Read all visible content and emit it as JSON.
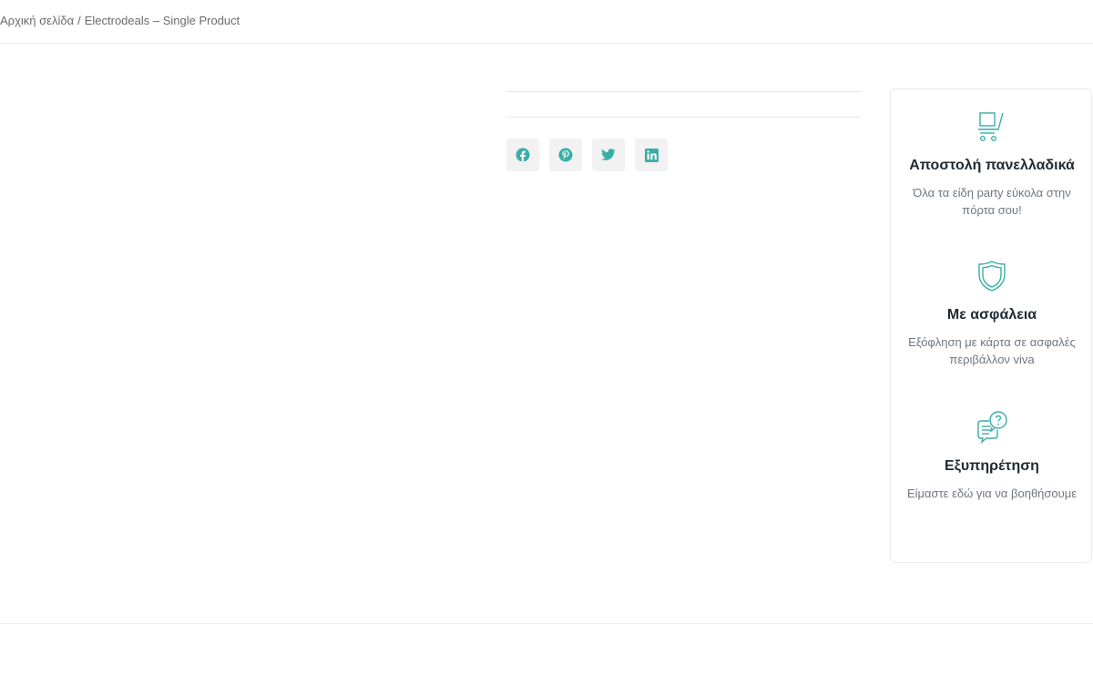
{
  "breadcrumb": {
    "home": "Αρχική σελίδα",
    "separator": "/",
    "current": "Electrodeals – Single Product"
  },
  "share": {
    "items": [
      {
        "icon": "facebook-icon"
      },
      {
        "icon": "pinterest-icon"
      },
      {
        "icon": "twitter-icon"
      },
      {
        "icon": "linkedin-icon"
      }
    ],
    "accent_color": "#3aaea8"
  },
  "features": [
    {
      "icon": "cart-icon",
      "title": "Αποστολή πανελλαδικά",
      "description": "Όλα τα είδη party εύκολα στην πόρτα σου!"
    },
    {
      "icon": "shield-icon",
      "title": "Με ασφάλεια",
      "description": "Εξόφληση με κάρτα σε ασφαλές περιβάλλον viva"
    },
    {
      "icon": "support-chat-icon",
      "title": "Εξυπηρέτηση",
      "description": "Είμαστε εδώ για να βοηθήσουμε"
    }
  ]
}
